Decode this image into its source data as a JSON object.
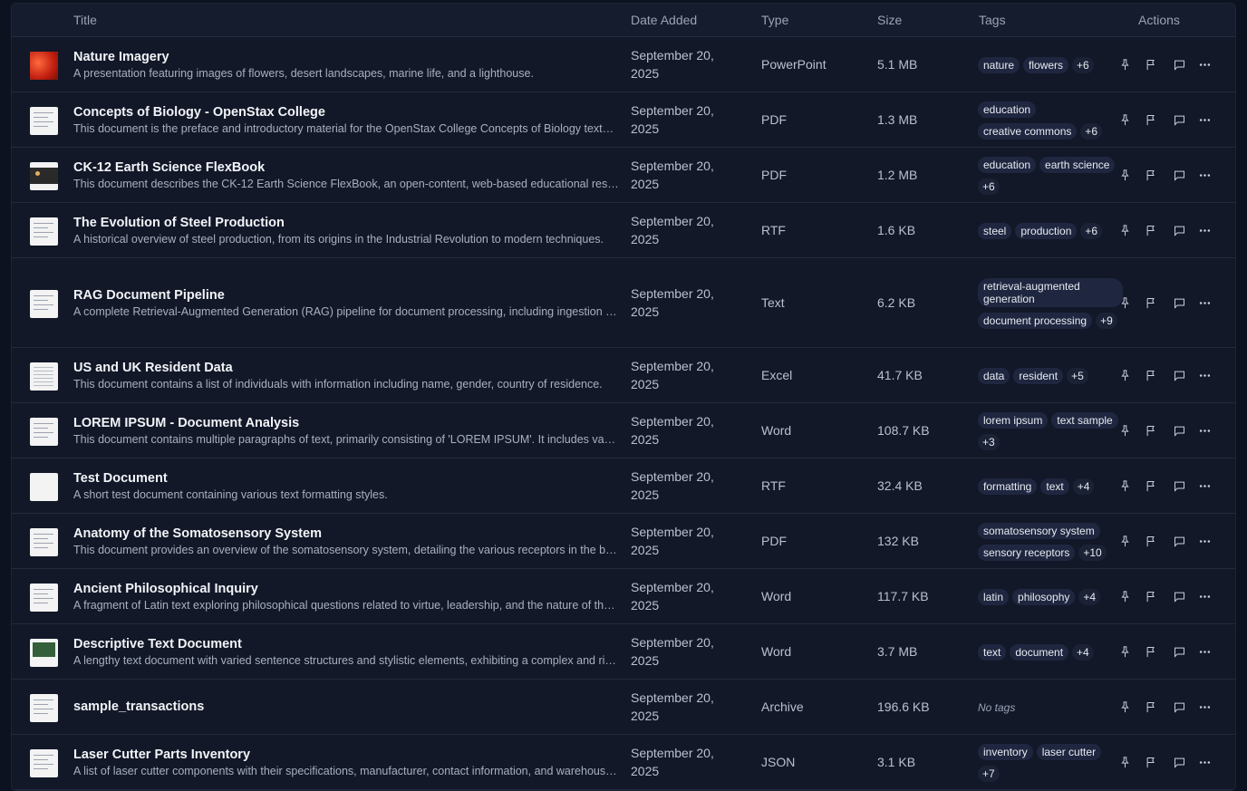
{
  "header": {
    "title": "Title",
    "date_added": "Date Added",
    "type": "Type",
    "size": "Size",
    "tags": "Tags",
    "actions": "Actions"
  },
  "no_tags_label": "No tags",
  "rows": [
    {
      "title": "Nature Imagery",
      "desc": "A presentation featuring images of flowers, desert landscapes, marine life, and a lighthouse.",
      "date1": "September 20,",
      "date2": "2025",
      "type": "PowerPoint",
      "size": "5.1 MB",
      "tags": [
        "nature",
        "flowers"
      ],
      "more": "+6",
      "thumb": "red"
    },
    {
      "title": "Concepts of Biology - OpenStax College",
      "desc": "This document is the preface and introductory material for the OpenStax College Concepts of Biology textbook.",
      "date1": "September 20,",
      "date2": "2025",
      "type": "PDF",
      "size": "1.3 MB",
      "tags": [
        "education",
        "creative commons"
      ],
      "more": "+6",
      "thumb": "doc"
    },
    {
      "title": "CK-12 Earth Science FlexBook",
      "desc": "This document describes the CK-12 Earth Science FlexBook, an open-content, web-based educational resource.",
      "date1": "September 20,",
      "date2": "2025",
      "type": "PDF",
      "size": "1.2 MB",
      "tags": [
        "education",
        "earth science"
      ],
      "more": "+6",
      "thumb": "dark"
    },
    {
      "title": "The Evolution of Steel Production",
      "desc": "A historical overview of steel production, from its origins in the Industrial Revolution to modern techniques.",
      "date1": "September 20,",
      "date2": "2025",
      "type": "RTF",
      "size": "1.6 KB",
      "tags": [
        "steel",
        "production"
      ],
      "more": "+6",
      "thumb": "doc"
    },
    {
      "title": "RAG Document Pipeline",
      "desc": "A complete Retrieval-Augmented Generation (RAG) pipeline for document processing, including ingestion and retrieval.",
      "date1": "September 20,",
      "date2": "2025",
      "type": "Text",
      "size": "6.2 KB",
      "tags": [
        "retrieval-augmented generation",
        "document processing"
      ],
      "more": "+9",
      "thumb": "doc"
    },
    {
      "title": "US and UK Resident Data",
      "desc": "This document contains a list of individuals with information including name, gender, country of residence.",
      "date1": "September 20,",
      "date2": "2025",
      "type": "Excel",
      "size": "41.7 KB",
      "tags": [
        "data",
        "resident"
      ],
      "more": "+5",
      "thumb": "grid"
    },
    {
      "title": "LOREM IPSUM - Document Analysis",
      "desc": "This document contains multiple paragraphs of text, primarily consisting of 'LOREM IPSUM'. It includes various sections.",
      "date1": "September 20,",
      "date2": "2025",
      "type": "Word",
      "size": "108.7 KB",
      "tags": [
        "lorem ipsum",
        "text sample"
      ],
      "more": "+3",
      "thumb": "doc"
    },
    {
      "title": "Test Document",
      "desc": "A short test document containing various text formatting styles.",
      "date1": "September 20,",
      "date2": "2025",
      "type": "RTF",
      "size": "32.4 KB",
      "tags": [
        "formatting",
        "text"
      ],
      "more": "+4",
      "thumb": "blank"
    },
    {
      "title": "Anatomy of the Somatosensory System",
      "desc": "This document provides an overview of the somatosensory system, detailing the various receptors in the body.",
      "date1": "September 20,",
      "date2": "2025",
      "type": "PDF",
      "size": "132 KB",
      "tags": [
        "somatosensory system",
        "sensory receptors"
      ],
      "more": "+10",
      "thumb": "doc"
    },
    {
      "title": "Ancient Philosophical Inquiry",
      "desc": "A fragment of Latin text exploring philosophical questions related to virtue, leadership, and the nature of the soul.",
      "date1": "September 20,",
      "date2": "2025",
      "type": "Word",
      "size": "117.7 KB",
      "tags": [
        "latin",
        "philosophy"
      ],
      "more": "+4",
      "thumb": "doc"
    },
    {
      "title": "Descriptive Text Document",
      "desc": "A lengthy text document with varied sentence structures and stylistic elements, exhibiting a complex and rich style.",
      "date1": "September 20,",
      "date2": "2025",
      "type": "Word",
      "size": "3.7 MB",
      "tags": [
        "text",
        "document"
      ],
      "more": "+4",
      "thumb": "green"
    },
    {
      "title": "sample_transactions",
      "desc": "",
      "date1": "September 20,",
      "date2": "2025",
      "type": "Archive",
      "size": "196.6 KB",
      "tags": [],
      "more": "",
      "thumb": "doc"
    },
    {
      "title": "Laser Cutter Parts Inventory",
      "desc": "A list of laser cutter components with their specifications, manufacturer, contact information, and warehouse location.",
      "date1": "September 20,",
      "date2": "2025",
      "type": "JSON",
      "size": "3.1 KB",
      "tags": [
        "inventory",
        "laser cutter"
      ],
      "more": "+7",
      "thumb": "doc"
    }
  ]
}
